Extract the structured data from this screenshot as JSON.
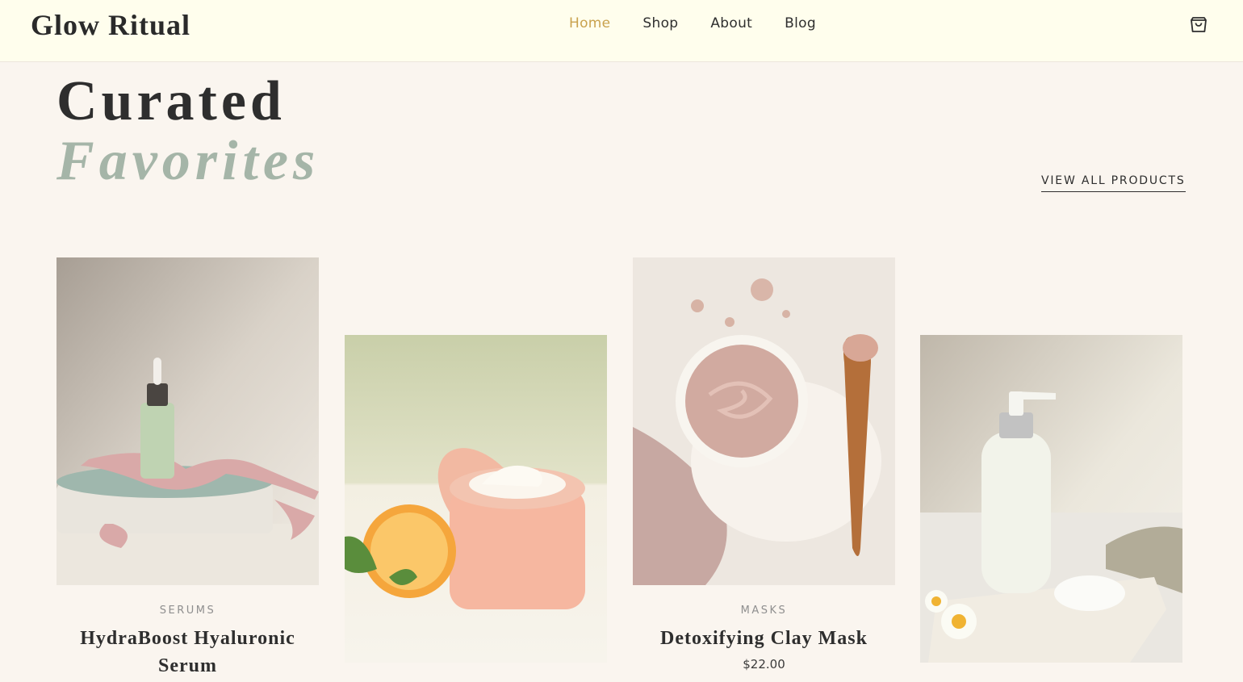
{
  "header": {
    "logo": "Glow Ritual",
    "nav": [
      {
        "label": "Home",
        "active": true
      },
      {
        "label": "Shop",
        "active": false
      },
      {
        "label": "About",
        "active": false
      },
      {
        "label": "Blog",
        "active": false
      }
    ],
    "cart_icon": "shopping-bag-icon"
  },
  "section": {
    "title_line1": "Curated",
    "title_line2": "Favorites",
    "view_all_label": "VIEW ALL PRODUCTS"
  },
  "products": [
    {
      "category": "SERUMS",
      "name": "HydraBoost Hyaluronic Serum",
      "image": "serum-bottle-image"
    },
    {
      "category": "",
      "name": "",
      "image": "cream-jar-image"
    },
    {
      "category": "MASKS",
      "name": "Detoxifying Clay Mask",
      "price": "$22.00",
      "image": "clay-mask-image"
    },
    {
      "category": "",
      "name": "",
      "image": "cleanser-bottle-image"
    }
  ],
  "colors": {
    "header_bg": "#fffeed",
    "page_bg": "#faf5ef",
    "accent_gold": "#c9a24e",
    "sage": "#a5b5a8",
    "text_dark": "#2e2e2e"
  }
}
